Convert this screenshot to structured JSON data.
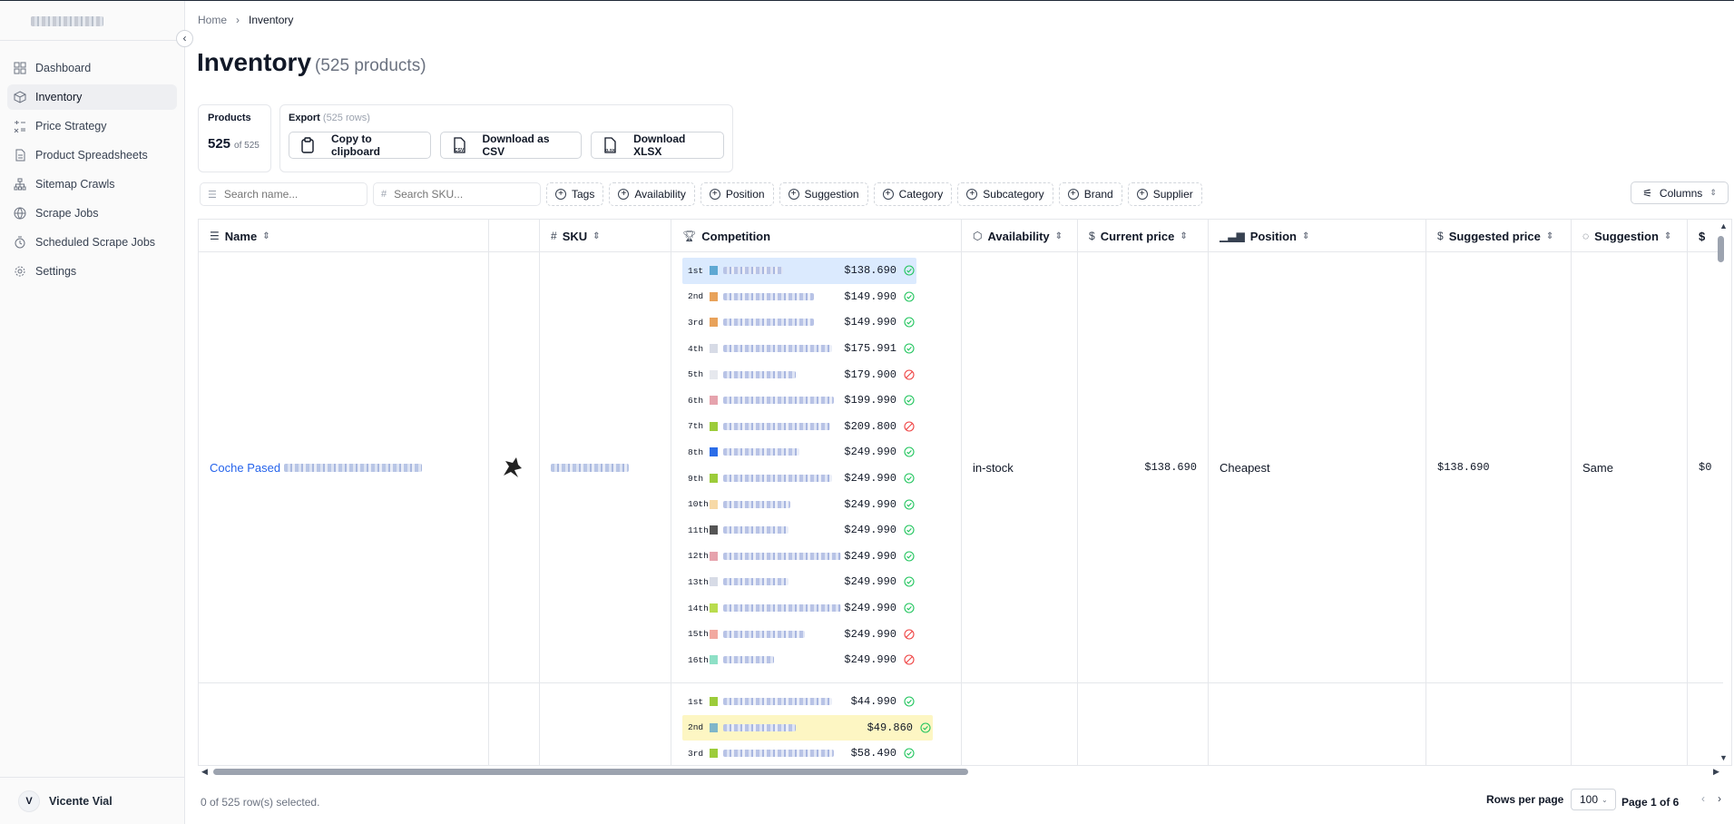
{
  "sidebar": {
    "items": [
      {
        "label": "Dashboard",
        "icon": "dashboard-icon"
      },
      {
        "label": "Inventory",
        "icon": "box-icon",
        "active": true
      },
      {
        "label": "Price Strategy",
        "icon": "price-strategy-icon"
      },
      {
        "label": "Product Spreadsheets",
        "icon": "spreadsheet-icon"
      },
      {
        "label": "Sitemap Crawls",
        "icon": "sitemap-icon"
      },
      {
        "label": "Scrape Jobs",
        "icon": "globe-icon"
      },
      {
        "label": "Scheduled Scrape Jobs",
        "icon": "clock-icon"
      },
      {
        "label": "Settings",
        "icon": "gear-icon"
      }
    ],
    "user": {
      "initial": "V",
      "name": "Vicente Vial"
    }
  },
  "breadcrumb": {
    "home": "Home",
    "current": "Inventory"
  },
  "page": {
    "title": "Inventory",
    "count": "(525 products)"
  },
  "products_card": {
    "label": "Products",
    "value": "525",
    "of": "of 525"
  },
  "export_card": {
    "label": "Export",
    "rows": "(525 rows)",
    "copy": "Copy to clipboard",
    "csv": "Download as CSV",
    "xlsx": "Download XLSX"
  },
  "filters": {
    "search_name_placeholder": "Search name...",
    "search_sku_placeholder": "Search SKU...",
    "buttons": [
      "Tags",
      "Availability",
      "Position",
      "Suggestion",
      "Category",
      "Subcategory",
      "Brand",
      "Supplier"
    ],
    "columns": "Columns"
  },
  "table": {
    "headers": {
      "name": "Name",
      "sku": "SKU",
      "competition": "Competition",
      "availability": "Availability",
      "current_price": "Current price",
      "position": "Position",
      "suggested_price": "Suggested price",
      "suggestion": "Suggestion",
      "next": "$"
    },
    "rows": [
      {
        "name": "Coche Pased",
        "availability": "in-stock",
        "current_price": "$138.690",
        "position": "Cheapest",
        "suggested_price": "$138.690",
        "suggestion": "Same",
        "next": "$0",
        "competition": [
          {
            "rank": "1st",
            "price": "$138.690",
            "status": "ok",
            "highlight": "self",
            "favicon_color": "#5fa8d3"
          },
          {
            "rank": "2nd",
            "price": "$149.990",
            "status": "ok",
            "favicon_color": "#e8a25a"
          },
          {
            "rank": "3rd",
            "price": "$149.990",
            "status": "ok",
            "favicon_color": "#e8a25a"
          },
          {
            "rank": "4th",
            "price": "$175.991",
            "status": "ok",
            "favicon_color": "#d7dbe6"
          },
          {
            "rank": "5th",
            "price": "$179.900",
            "status": "blocked",
            "favicon_color": "#e6e8ee"
          },
          {
            "rank": "6th",
            "price": "$199.990",
            "status": "ok",
            "favicon_color": "#e6a3ad"
          },
          {
            "rank": "7th",
            "price": "$209.800",
            "status": "blocked",
            "favicon_color": "#9ccc3a"
          },
          {
            "rank": "8th",
            "price": "$249.990",
            "status": "ok",
            "favicon_color": "#2b6de8"
          },
          {
            "rank": "9th",
            "price": "$249.990",
            "status": "ok",
            "favicon_color": "#9ccc3a"
          },
          {
            "rank": "10th",
            "price": "$249.990",
            "status": "ok",
            "favicon_color": "#f7d9a6"
          },
          {
            "rank": "11th",
            "price": "$249.990",
            "status": "ok",
            "favicon_color": "#555555"
          },
          {
            "rank": "12th",
            "price": "$249.990",
            "status": "ok",
            "favicon_color": "#e6a3ad"
          },
          {
            "rank": "13th",
            "price": "$249.990",
            "status": "ok",
            "favicon_color": "#d7dbe6"
          },
          {
            "rank": "14th",
            "price": "$249.990",
            "status": "ok",
            "favicon_color": "#b9dc4e"
          },
          {
            "rank": "15th",
            "price": "$249.990",
            "status": "blocked",
            "favicon_color": "#f2a9a0"
          },
          {
            "rank": "16th",
            "price": "$249.990",
            "status": "blocked",
            "favicon_color": "#8ee0c6"
          }
        ]
      },
      {
        "competition": [
          {
            "rank": "1st",
            "price": "$44.990",
            "status": "ok",
            "favicon_color": "#9ccc3a"
          },
          {
            "rank": "2nd",
            "price": "$49.860",
            "status": "ok",
            "highlight": "self",
            "favicon_color": "#7fb6c9"
          },
          {
            "rank": "3rd",
            "price": "$58.490",
            "status": "ok",
            "favicon_color": "#9ccc3a"
          }
        ]
      }
    ]
  },
  "footer": {
    "selected": "0 of 525 row(s) selected.",
    "rows_per_page_label": "Rows per page",
    "rows_per_page": "100",
    "page_info": "Page 1 of 6"
  }
}
